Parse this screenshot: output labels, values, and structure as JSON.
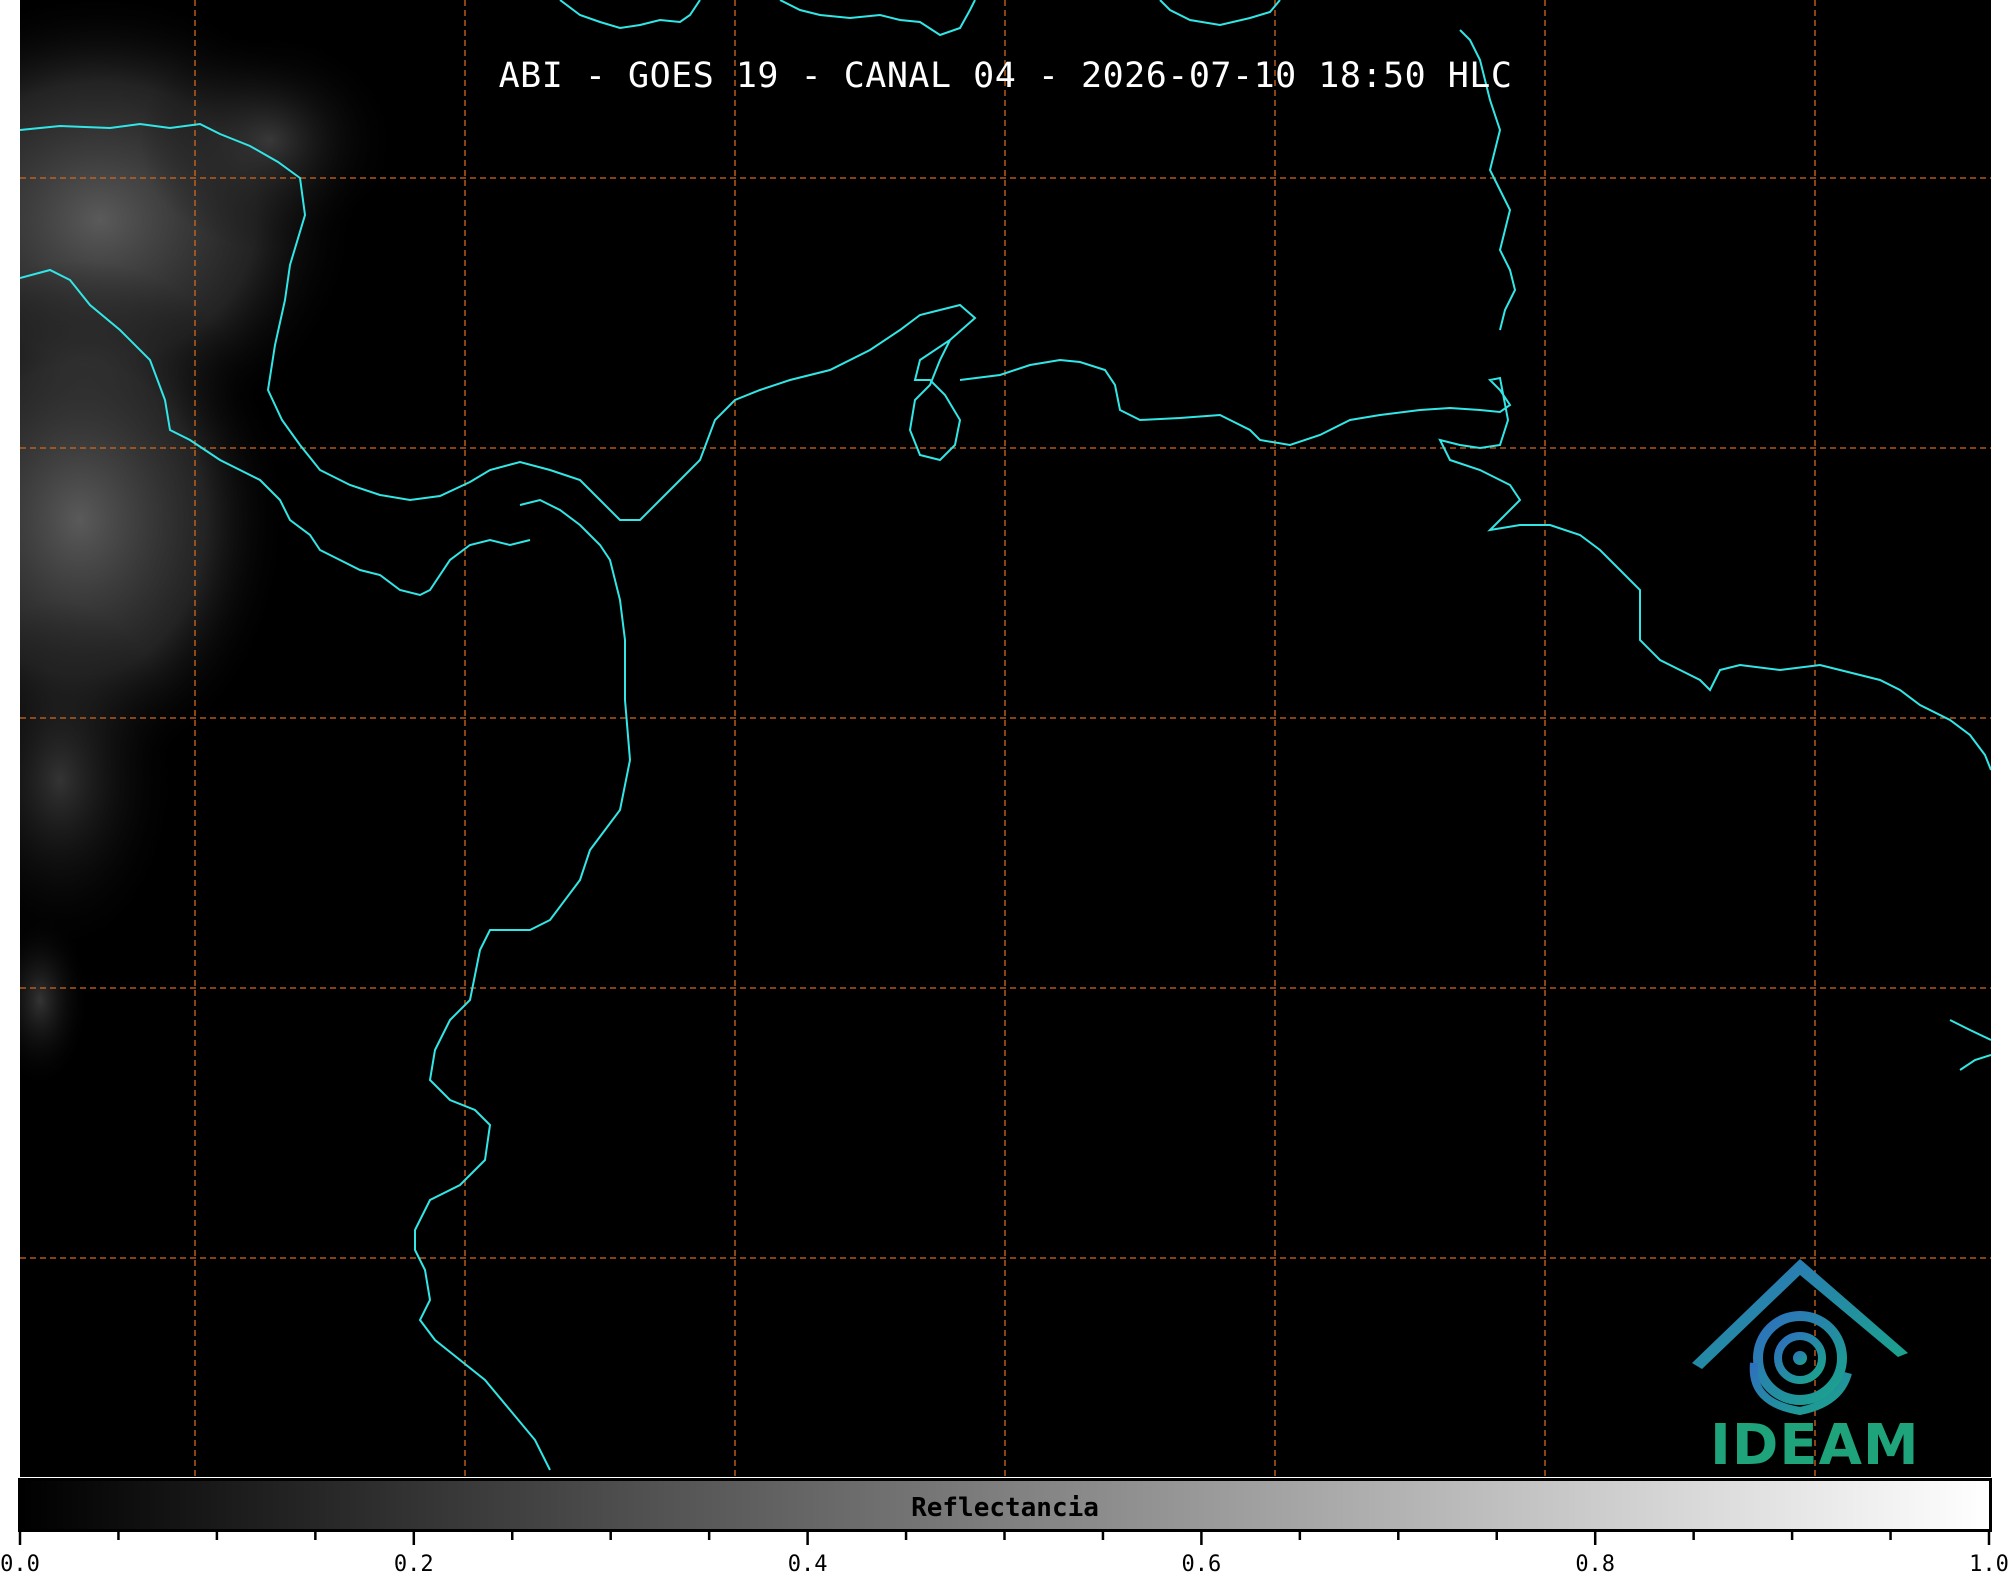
{
  "title": "ABI - GOES 19 - CANAL 04 - 2026-07-10 18:50 HLC",
  "colorbar": {
    "label": "Reflectancia",
    "min": 0.0,
    "max": 1.0,
    "major_ticks": [
      "0.0",
      "0.2",
      "0.4",
      "0.6",
      "0.8",
      "1.0"
    ],
    "minor_tick_step": 0.05,
    "colormap": [
      "#000000",
      "#ffffff"
    ]
  },
  "map": {
    "background_color": "#000000",
    "coastline_color": "#33e6e6",
    "gridline_color": "#d2691e",
    "gridline_style": "dashed",
    "cloud_color": "#5a5a5a"
  },
  "logo": {
    "text": "IDEAM",
    "text_color": "#1fa37a",
    "icon_colors": [
      "#2f6fbf",
      "#1aa58a"
    ]
  }
}
